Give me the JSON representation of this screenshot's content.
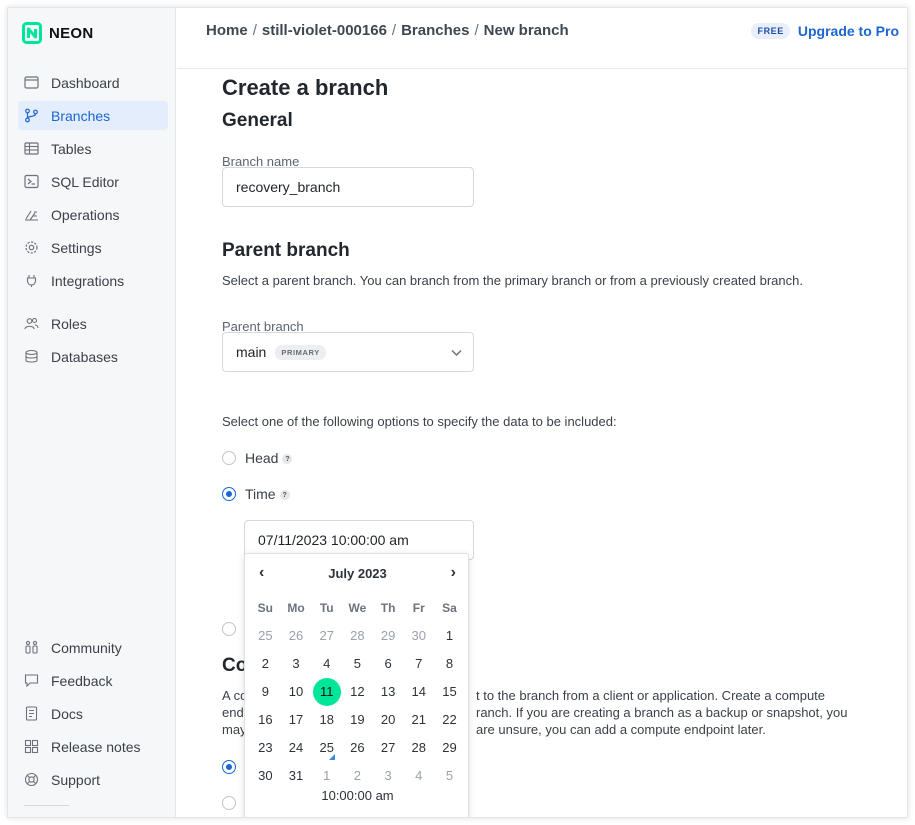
{
  "brand": {
    "name": "NEON",
    "accent": "#00e699"
  },
  "sidebar": {
    "items": [
      {
        "label": "Dashboard",
        "icon": "dashboard-icon"
      },
      {
        "label": "Branches",
        "icon": "branch-icon",
        "active": true
      },
      {
        "label": "Tables",
        "icon": "table-icon"
      },
      {
        "label": "SQL Editor",
        "icon": "terminal-icon"
      },
      {
        "label": "Operations",
        "icon": "operations-icon"
      },
      {
        "label": "Settings",
        "icon": "gear-icon"
      },
      {
        "label": "Integrations",
        "icon": "integrations-icon"
      },
      {
        "label": "Roles",
        "icon": "users-icon"
      },
      {
        "label": "Databases",
        "icon": "database-icon"
      }
    ],
    "bottom_items": [
      {
        "label": "Community",
        "icon": "community-icon"
      },
      {
        "label": "Feedback",
        "icon": "feedback-icon"
      },
      {
        "label": "Docs",
        "icon": "docs-icon"
      },
      {
        "label": "Release notes",
        "icon": "release-notes-icon"
      },
      {
        "label": "Support",
        "icon": "support-icon"
      }
    ]
  },
  "header": {
    "breadcrumbs": [
      "Home",
      "still-violet-000166",
      "Branches",
      "New branch"
    ],
    "plan_badge": "FREE",
    "upgrade_label": "Upgrade to Pro"
  },
  "main": {
    "title": "Create a branch",
    "general_heading": "General",
    "branch_name_label": "Branch name",
    "branch_name_value": "recovery_branch",
    "parent_heading": "Parent branch",
    "parent_desc": "Select a parent branch. You can branch from the primary branch or from a previously created branch.",
    "parent_label": "Parent branch",
    "parent_value": "main",
    "parent_badge": "PRIMARY",
    "data_options_desc": "Select one of the following options to specify the data to be included:",
    "option_head": "Head",
    "option_time": "Time",
    "help_glyph": "?",
    "time_value": "07/11/2023 10:00:00 am",
    "compute_heading_partial": "Co",
    "compute_line1_left": "A co",
    "compute_line1_right": "t to the branch from a client or application. Create a compute",
    "compute_line2_left": "end",
    "compute_line2_right": "ranch. If you are creating a branch as a backup or snapshot, you",
    "compute_line3_left": "may",
    "compute_line3_right": "are unsure, you can add a compute endpoint later."
  },
  "calendar": {
    "month_label": "July 2023",
    "prev_glyph": "‹",
    "next_glyph": "›",
    "weekdays": [
      "Su",
      "Mo",
      "Tu",
      "We",
      "Th",
      "Fr",
      "Sa"
    ],
    "weeks": [
      [
        "25",
        "26",
        "27",
        "28",
        "29",
        "30",
        "1"
      ],
      [
        "2",
        "3",
        "4",
        "5",
        "6",
        "7",
        "8"
      ],
      [
        "9",
        "10",
        "11",
        "12",
        "13",
        "14",
        "15"
      ],
      [
        "16",
        "17",
        "18",
        "19",
        "20",
        "21",
        "22"
      ],
      [
        "23",
        "24",
        "25",
        "26",
        "27",
        "28",
        "29"
      ],
      [
        "30",
        "31",
        "1",
        "2",
        "3",
        "4",
        "5"
      ]
    ],
    "selected_day": "11",
    "today_day": "25",
    "time": "10:00:00 am"
  }
}
